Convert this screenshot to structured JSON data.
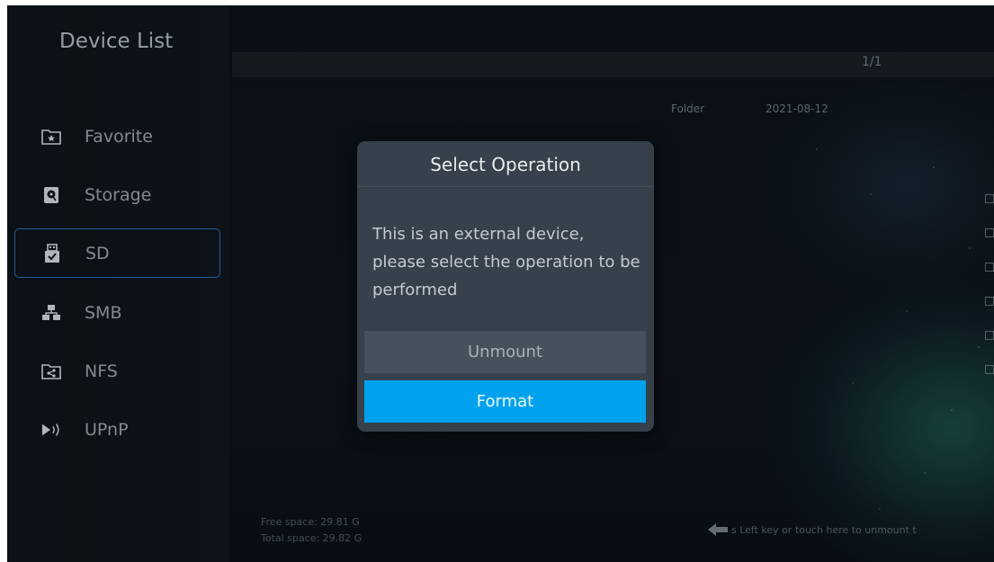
{
  "sidebar": {
    "title": "Device List",
    "items": [
      {
        "label": "Favorite",
        "icon": "favorite-folder-icon"
      },
      {
        "label": "Storage",
        "icon": "storage-icon"
      },
      {
        "label": "SD",
        "icon": "usb-device-icon",
        "selected": true
      },
      {
        "label": "SMB",
        "icon": "network-icon"
      },
      {
        "label": "NFS",
        "icon": "shared-folder-icon"
      },
      {
        "label": "UPnP",
        "icon": "upnp-icon"
      }
    ]
  },
  "browser": {
    "page_count": "1/1",
    "row": {
      "type": "Folder",
      "date": "2021-08-12"
    }
  },
  "footer": {
    "free_space": "Free space: 29.81 G",
    "total_space": "Total space: 29.82 G",
    "hint": "s Left key or touch here to unmount t"
  },
  "dialog": {
    "title": "Select Operation",
    "message": "This is an external device, please select the operation to be performed",
    "buttons": {
      "unmount": "Unmount",
      "format": "Format"
    }
  },
  "colors": {
    "accent": "#00a2ee",
    "dialog_bg": "#36414b",
    "selected_border": "#2e6aa8"
  }
}
